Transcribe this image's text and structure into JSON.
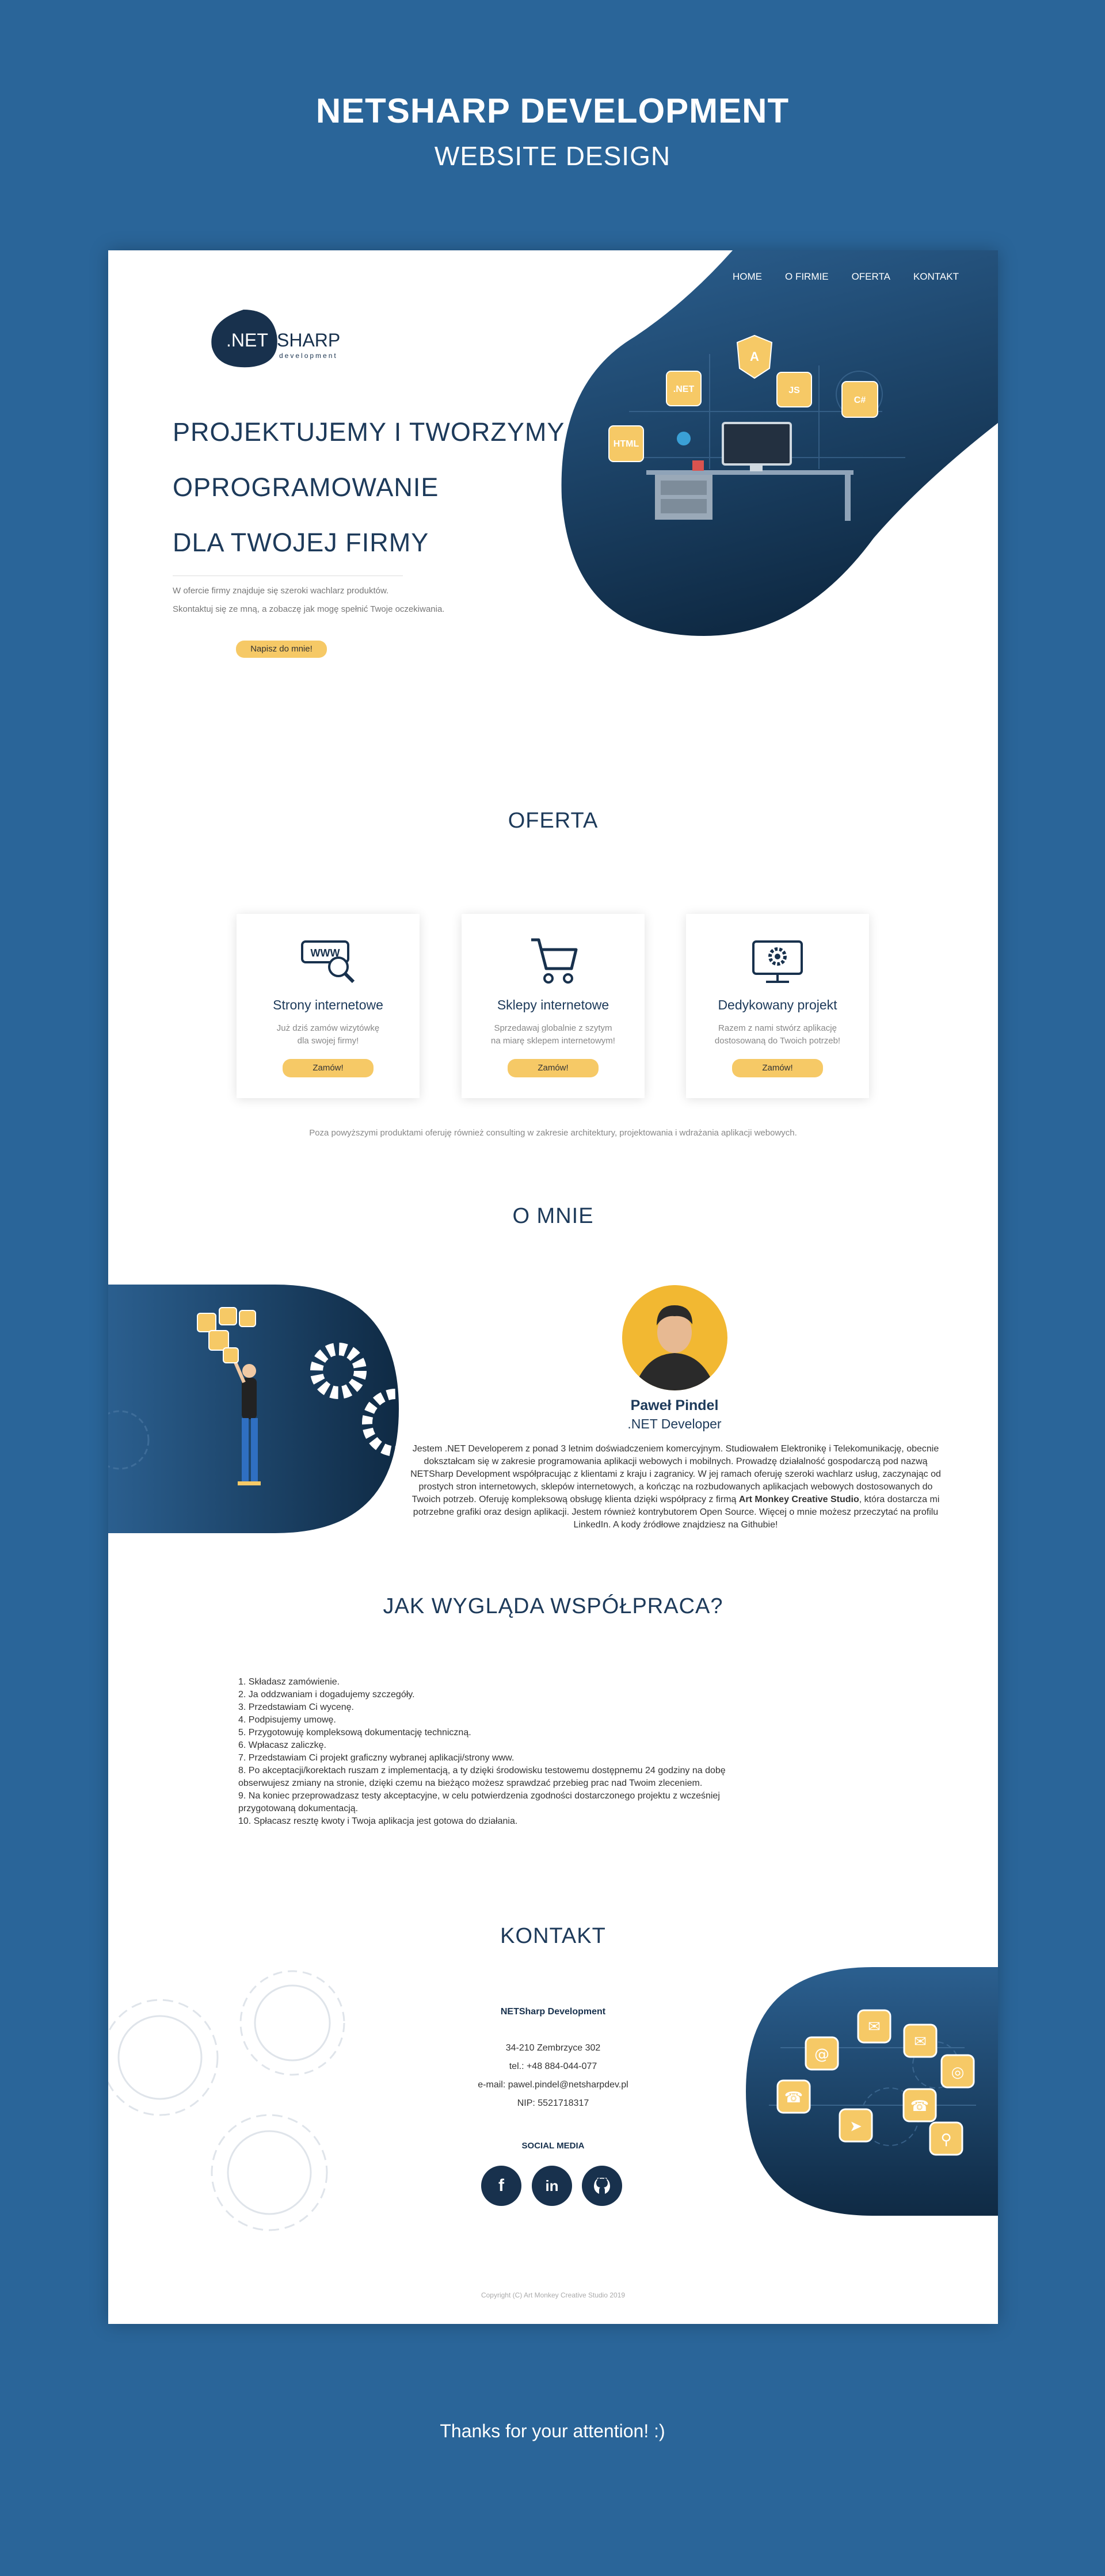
{
  "presentation": {
    "title": "NETSHARP DEVELOPMENT",
    "subtitle": "WEBSITE DESIGN",
    "thanks": "Thanks for your attention! :)"
  },
  "colors": {
    "background": "#2a6599",
    "navy": "#18314d",
    "accent": "#f6c966",
    "white": "#ffffff"
  },
  "nav": {
    "items": [
      "HOME",
      "O FIRMIE",
      "OFERTA",
      "KONTAKT"
    ]
  },
  "logo": {
    "net": ".NET",
    "sharp": "SHARP",
    "tag": "development"
  },
  "hero": {
    "line1": "PROJEKTUJEMY I TWORZYMY",
    "line2": "OPROGRAMOWANIE",
    "line3": "DLA TWOJEJ FIRMY",
    "desc1": "W ofercie firmy znajduje się szeroki wachlarz produktów.",
    "desc2": "Skontaktuj się ze mną, a zobaczę jak mogę spełnić Twoje oczekiwania.",
    "cta": "Napisz do mnie!",
    "tiles": [
      ".NET",
      "A",
      "JS",
      "C#",
      "HTML"
    ]
  },
  "offer": {
    "title": "OFERTA",
    "cards": [
      {
        "icon": "www-search-icon",
        "title": "Strony internetowe",
        "desc1": "Już dziś zamów wizytówkę",
        "desc2": "dla swojej firmy!",
        "button": "Zamów!"
      },
      {
        "icon": "shopping-cart-icon",
        "title": "Sklepy internetowe",
        "desc1": "Sprzedawaj globalnie z szytym",
        "desc2": "na miarę sklepem internetowym!",
        "button": "Zamów!"
      },
      {
        "icon": "monitor-gear-icon",
        "title": "Dedykowany projekt",
        "desc1": "Razem z nami stwórz aplikację",
        "desc2": "dostosowaną do Twoich potrzeb!",
        "button": "Zamów!"
      }
    ],
    "note": "Poza powyższymi produktami oferuję również consulting w zakresie architektury, projektowania i wdrażania aplikacji webowych."
  },
  "about": {
    "title": "O MNIE",
    "name": "Paweł Pindel",
    "role": ".NET Developer",
    "bio1": "Jestem .NET Developerem z ponad 3 letnim doświadczeniem komercyjnym. Studiowałem Elektronikę i Telekomunikację, obecnie dokształcam się  w zakresie programowania aplikacji webowych i mobilnych. Prowadzę działalność gospodarczą pod nazwą NETSharp Development współpracując z klientami z kraju i zagranicy. W jej ramach oferuję szeroki wachlarz usług, zaczynając od prostych stron internetowych, sklepów internetowych, a kończąc na rozbudowanych aplikacjach webowych dostosowanych do Twoich potrzeb. Oferuję kompleksową obsługę klienta dzięki współpracy z firmą ",
    "bio_bold": "Art Monkey Creative Studio",
    "bio2": ", która dostarcza mi potrzebne grafiki oraz design aplikacji. Jestem również kontrybutorem Open Source. Więcej o mnie możesz przeczytać na profilu LinkedIn. A kody źródłowe znajdziesz na Githubie!"
  },
  "process": {
    "title": "JAK WYGLĄDA WSPÓŁPRACA?",
    "steps": [
      "1. Składasz zamówienie.",
      "2. Ja oddzwaniam i dogadujemy szczegóły.",
      "3. Przedstawiam Ci wycenę.",
      "4. Podpisujemy umowę.",
      "5. Przygotowuję kompleksową dokumentację techniczną.",
      "6. Wpłacasz zaliczkę.",
      "7. Przedstawiam Ci projekt graficzny wybranej aplikacji/strony www.",
      "8. Po akceptacji/korektach ruszam z implementacją, a ty dzięki środowisku testowemu dostępnemu 24 godziny na dobę obserwujesz zmiany na stronie, dzięki czemu na bieżąco możesz sprawdzać przebieg prac nad Twoim zleceniem.",
      "9. Na koniec przeprowadzasz testy akceptacyjne, w celu potwierdzenia zgodności dostarczonego projektu z wcześniej przygotowaną dokumentacją.",
      "10. Spłacasz resztę kwoty i Twoja aplikacja jest gotowa do działania."
    ]
  },
  "contact": {
    "title": "KONTAKT",
    "company": "NETSharp Development",
    "address": "34-210 Zembrzyce 302",
    "phone": "tel.: +48 884-044-077",
    "email": "e-mail: pawel.pindel@netsharpdev.pl",
    "nip": "NIP: 5521718317",
    "social_title": "SOCIAL MEDIA",
    "social": [
      "f",
      "in",
      "gh"
    ]
  },
  "footer": {
    "copyright": "Copyright (C) Art Monkey Creative Studio 2019"
  }
}
